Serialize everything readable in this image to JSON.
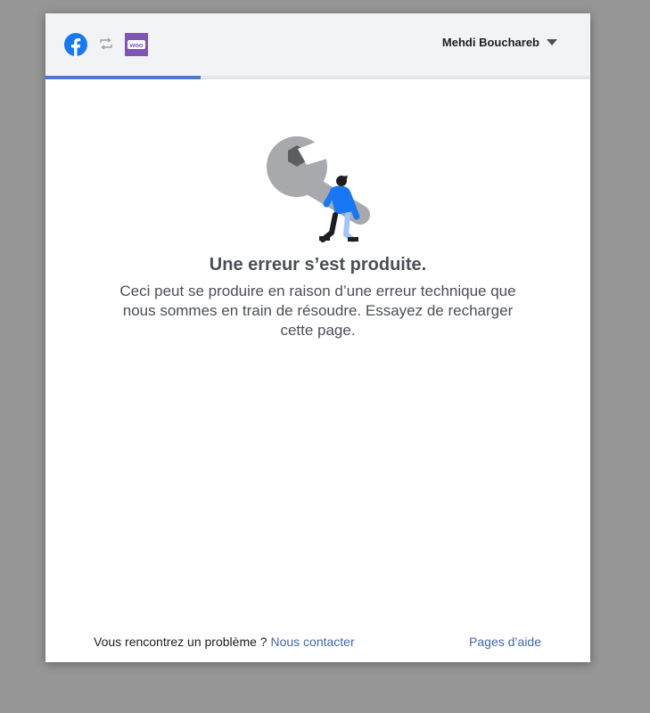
{
  "header": {
    "user_name": "Mehdi Bouchareb",
    "icons": [
      "facebook-logo",
      "sync-arrows",
      "woocommerce-logo"
    ],
    "woo_logo_text": "woo"
  },
  "progress": {
    "fraction": 0.285,
    "color": "#4a7bd0"
  },
  "error": {
    "title": "Une erreur s’est produite.",
    "message": "Ceci peut se produire en raison d’une erreur technique que nous sommes en train de résoudre. Essayez de recharger cette page."
  },
  "footer": {
    "problem_text": "Vous rencontrez un problème ?",
    "contact_link": "Nous contacter",
    "help_link": "Pages d’aide"
  },
  "colors": {
    "facebook_blue": "#1877f2",
    "woo_purple": "#7f54b3",
    "link": "#4267b2"
  }
}
